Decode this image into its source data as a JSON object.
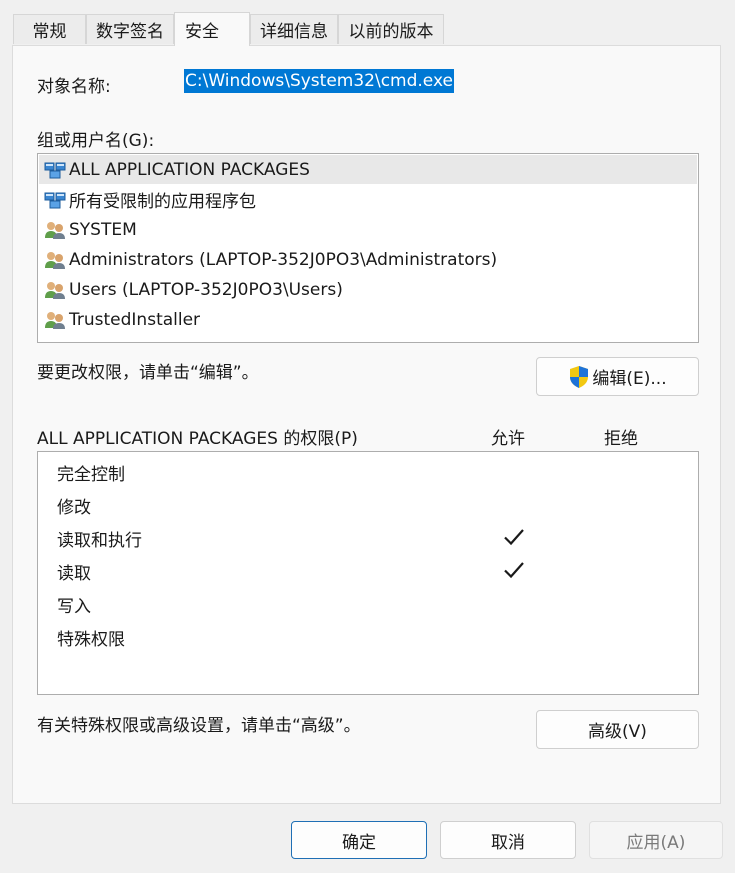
{
  "tabs": [
    {
      "label": "常规"
    },
    {
      "label": "数字签名"
    },
    {
      "label": "安全"
    },
    {
      "label": "详细信息"
    },
    {
      "label": "以前的版本"
    }
  ],
  "object": {
    "label": "对象名称:",
    "value": "C:\\Windows\\System32\\cmd.exe"
  },
  "groups": {
    "label": "组或用户名(G):",
    "items": [
      {
        "name": "ALL APPLICATION PACKAGES",
        "icon": "package-group-icon"
      },
      {
        "name": "所有受限制的应用程序包",
        "icon": "package-group-icon"
      },
      {
        "name": "SYSTEM",
        "icon": "users-icon"
      },
      {
        "name": "Administrators (LAPTOP-352J0PO3\\Administrators)",
        "icon": "users-icon"
      },
      {
        "name": "Users (LAPTOP-352J0PO3\\Users)",
        "icon": "users-icon"
      },
      {
        "name": "TrustedInstaller",
        "icon": "users-icon"
      }
    ]
  },
  "edit": {
    "hint": "要更改权限，请单击“编辑”。",
    "button": "编辑(E)..."
  },
  "permissions": {
    "label": "ALL APPLICATION PACKAGES 的权限(P)",
    "allow_header": "允许",
    "deny_header": "拒绝",
    "rows": [
      {
        "name": "完全控制",
        "allow": false,
        "deny": false
      },
      {
        "name": "修改",
        "allow": false,
        "deny": false
      },
      {
        "name": "读取和执行",
        "allow": true,
        "deny": false
      },
      {
        "name": "读取",
        "allow": true,
        "deny": false
      },
      {
        "name": "写入",
        "allow": false,
        "deny": false
      },
      {
        "name": "特殊权限",
        "allow": false,
        "deny": false
      }
    ]
  },
  "advanced": {
    "hint": "有关特殊权限或高级设置，请单击“高级”。",
    "button": "高级(V)"
  },
  "footer": {
    "ok": "确定",
    "cancel": "取消",
    "apply": "应用(A)"
  },
  "colors": {
    "accent": "#0078d4",
    "selection_row": "#e8e8e8",
    "disabled_text": "#7a7a7a"
  }
}
